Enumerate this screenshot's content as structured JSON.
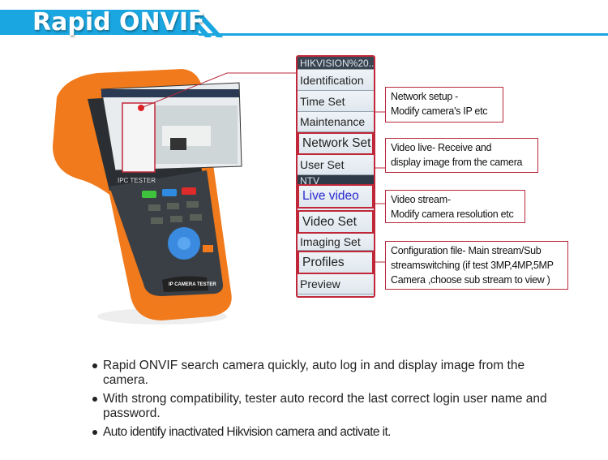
{
  "header": {
    "title": "Rapid ONVIF",
    "accent": "#1aa6e0"
  },
  "device": {
    "screen_label": "IPC TESTER",
    "body_label": "IP CAMERA TESTER",
    "body_color": "#f07a1c"
  },
  "menu": {
    "header": "HIKVISION%20...",
    "items": [
      "Identification",
      "Time Set",
      "Maintenance",
      "Network Set",
      "User Set"
    ],
    "section": "NTV",
    "items2": [
      "Live video",
      "Video Set",
      "Imaging Set",
      "Profiles",
      "Preview"
    ],
    "highlight_color": "#c0283a"
  },
  "callouts": [
    {
      "line1": "Network setup -",
      "line2": "Modify camera's  IP etc"
    },
    {
      "line1": "Video live- Receive and",
      "line2": "display image from the camera"
    },
    {
      "line1": "Video stream-",
      "line2": "Modify camera resolution etc"
    },
    {
      "line1": "Configuration file- Main stream/Sub",
      "line2": "streamswitching (if test 3MP,4MP,5MP",
      "line3": "Camera  ,choose sub stream to view )"
    }
  ],
  "bullets": [
    "Rapid ONVIF search camera quickly, auto log in and display image from the camera.",
    "With strong compatibility, tester auto record the last correct login user name and password.",
    "Auto identify inactivated Hikvision camera and activate it."
  ]
}
